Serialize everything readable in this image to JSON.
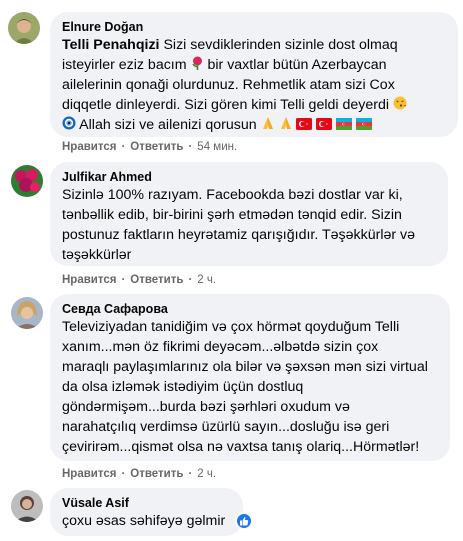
{
  "comments": [
    {
      "author": "Elnure Doğan",
      "mention": "Telli Penahqizi",
      "lines": [
        "Sizi sevdiklerinden sizinle dost olmaq",
        "isteyirler eziz bacım",
        "bir vaxtlar bütün Azerbaycan",
        "ailelerinin qonaği olurdunuz. Rehmetlik atam sizi Cox",
        "diqqetle dinleyerdi. Sizi gören kimi Telli geldi deyerdi",
        "Allah sizi ve ailenizi qorusun"
      ],
      "like_label": "Нравится",
      "reply_label": "Ответить",
      "time": "54 мин.",
      "avatar_icon": "avatar-photo-icon",
      "emoji_icons": [
        "rose-icon",
        "smiley-kiss-icon",
        "evil-eye-icon",
        "folded-hands-icon",
        "folded-hands-icon",
        "turkey-flag-icon",
        "turkey-flag-icon",
        "azerbaijan-flag-icon",
        "azerbaijan-flag-icon"
      ]
    },
    {
      "author": "Julfikar Ahmed",
      "lines": [
        "Sizinlə 100% razıyam. Facebookda bəzi dostlar var ki,",
        "tənbəllik edib, bir-birini şərh etmədən tənqid edir. Sizin",
        "postunuz faktların heyrətamiz qarışığıdır. Təşəkkürlər və",
        "təşəkkürlər"
      ],
      "like_label": "Нравится",
      "reply_label": "Ответить",
      "time": "2 ч.",
      "avatar_icon": "avatar-flowers-icon"
    },
    {
      "author": "Севда Сафарова",
      "lines": [
        "Televiziyadan tanidiğim və çox hörmət qoyduğum Telli",
        "xanım...mən öz fikrimi deyəcəm...əlbətdə sizin çox",
        "maraqlı paylaşımlarınız ola bilər və şəxsən mən sizi virtual",
        "da olsa izləmək istədiyim üçün dostluq",
        "göndərmişəm...burda bəzi şərhləri oxudum və",
        "narahatçılıq verdimsə üzürlü sayın...dosluğu isə geri",
        "çevirirəm...qismət olsa nə vaxtsa tanış olariq...Hörmətlər!"
      ],
      "like_label": "Нравится",
      "reply_label": "Ответить",
      "time": "2 ч.",
      "avatar_icon": "avatar-woman-icon"
    },
    {
      "author": "Vüsale Asif",
      "lines": [
        "çoxu əsas səhifəyə gəlmir"
      ],
      "avatar_icon": "avatar-person-icon",
      "reaction_icon": "like-thumb-icon"
    }
  ],
  "colors": {
    "bubble": "#f0f2f5",
    "text": "#050505",
    "secondary": "#65676b",
    "like_blue": "#1877f2"
  }
}
